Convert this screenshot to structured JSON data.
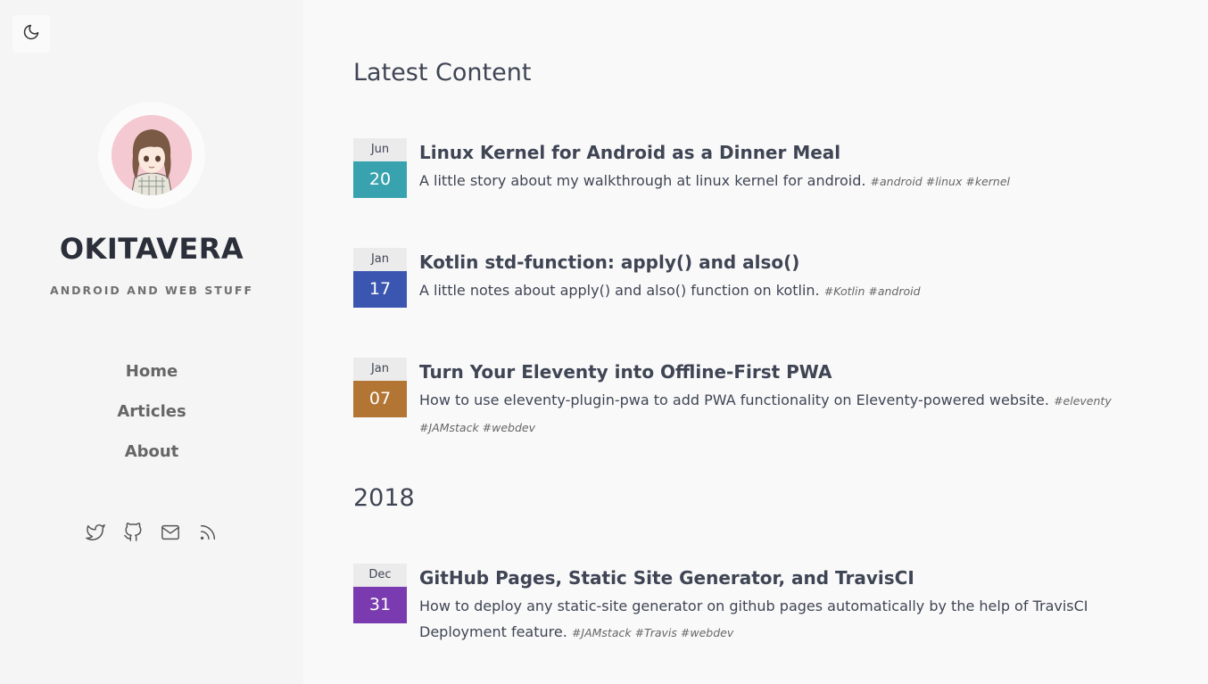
{
  "site": {
    "title": "OKITAVERA",
    "tagline": "ANDROID AND WEB STUFF"
  },
  "nav": {
    "items": [
      {
        "label": "Home"
      },
      {
        "label": "Articles"
      },
      {
        "label": "About"
      }
    ]
  },
  "social": [
    "twitter-icon",
    "github-icon",
    "mail-icon",
    "rss-icon"
  ],
  "main": {
    "heading": "Latest Content",
    "year_heading": "2018",
    "posts": [
      {
        "month": "Jun",
        "day": "20",
        "color": "#38a2ae",
        "title": "Linux Kernel for Android as a Dinner Meal",
        "description": "A little story about my walkthrough at linux kernel for android.",
        "tags": [
          "#android",
          "#linux",
          "#kernel"
        ]
      },
      {
        "month": "Jan",
        "day": "17",
        "color": "#3a56b0",
        "title": "Kotlin std-function: apply() and also()",
        "description": "A little notes about apply() and also() function on kotlin.",
        "tags": [
          "#Kotlin",
          "#android"
        ]
      },
      {
        "month": "Jan",
        "day": "07",
        "color": "#b27533",
        "title": "Turn Your Eleventy into Offline-First PWA",
        "description": "How to use eleventy-plugin-pwa to add PWA functionality on Eleventy-powered website.",
        "tags": [
          "#eleventy",
          "#JAMstack",
          "#webdev"
        ]
      },
      {
        "month": "Dec",
        "day": "31",
        "color": "#7a3ab0",
        "title": "GitHub Pages, Static Site Generator, and TravisCI",
        "description": "How to deploy any static-site generator on github pages automatically by the help of TravisCI Deployment feature.",
        "tags": [
          "#JAMstack",
          "#Travis",
          "#webdev"
        ]
      }
    ]
  }
}
